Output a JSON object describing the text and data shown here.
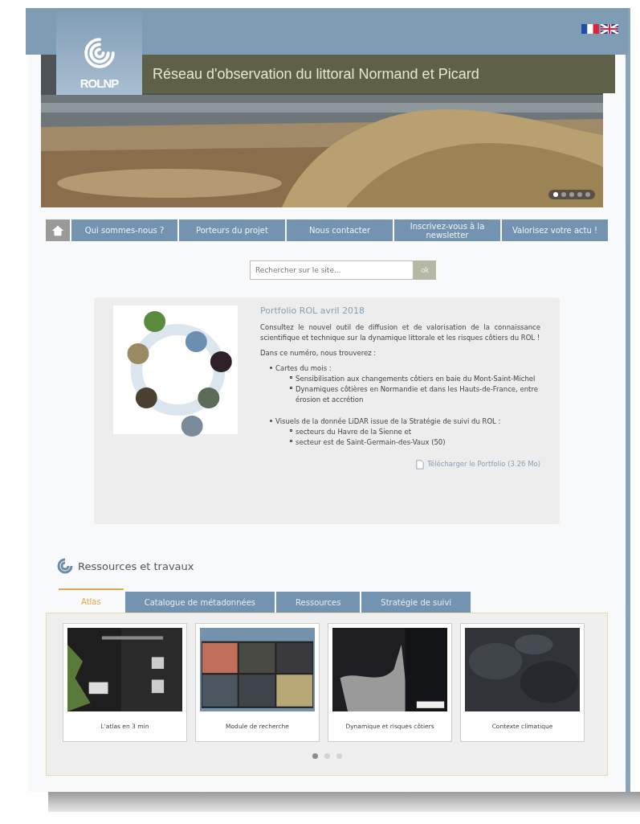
{
  "header": {
    "logo_text": "ROLNP",
    "title": "Réseau d'observation du littoral Normand et Picard",
    "banner": {
      "slides": [
        {
          "selected": true
        },
        {
          "selected": false
        },
        {
          "selected": false
        },
        {
          "selected": false
        },
        {
          "selected": false
        }
      ]
    }
  },
  "nav": {
    "items": [
      {
        "label": "Qui sommes-nous ?"
      },
      {
        "label": "Porteurs du projet"
      },
      {
        "label": "Nous contacter"
      },
      {
        "label": "Inscrivez-vous à la newsletter"
      },
      {
        "label": "Valorisez votre actu !"
      }
    ]
  },
  "search": {
    "placeholder": "Rechercher sur le site...",
    "button": "ok"
  },
  "feature": {
    "title": "Portfolio ROL avril 2018",
    "intro": "Consultez le nouvel outil de diffusion et de valorisation de la connaissance scientifique et technique sur la dynamique littorale et les risques côtiers du ROL !",
    "lead": "Dans ce numéro, nous trouverez :",
    "items": [
      {
        "text": "Cartes du mois :",
        "children": [
          {
            "text": "Sensibilisation aux changements côtiers en baie du Mont-Saint-Michel"
          },
          {
            "text": "Dynamiques côtières en Normandie et dans les Hauts-de-France, entre érosion et accrétion"
          }
        ]
      },
      {
        "text": "Visuels de la donnée LiDAR issue de la Stratégie de suivi du ROL :",
        "children": [
          {
            "text": "secteurs du Havre de la Sienne et"
          },
          {
            "text": "secteur est de Saint-Germain-des-Vaux (50)"
          }
        ]
      }
    ],
    "download": "Télécharger le Portfolio (3.26 Mo)"
  },
  "resources": {
    "heading": "Ressources et travaux",
    "tabs": [
      {
        "label": "Atlas",
        "selected": true
      },
      {
        "label": "Catalogue de métadonnées",
        "selected": false
      },
      {
        "label": "Ressources",
        "selected": false
      },
      {
        "label": "Stratégie de suivi",
        "selected": false
      }
    ],
    "cards": [
      {
        "caption": "L'atlas en 3 min"
      },
      {
        "caption": "Module de recherche"
      },
      {
        "caption": "Dynamique et risques côtiers"
      },
      {
        "caption": "Contexte climatique"
      }
    ],
    "pages": [
      {
        "selected": true
      },
      {
        "selected": false
      },
      {
        "selected": false
      }
    ]
  }
}
